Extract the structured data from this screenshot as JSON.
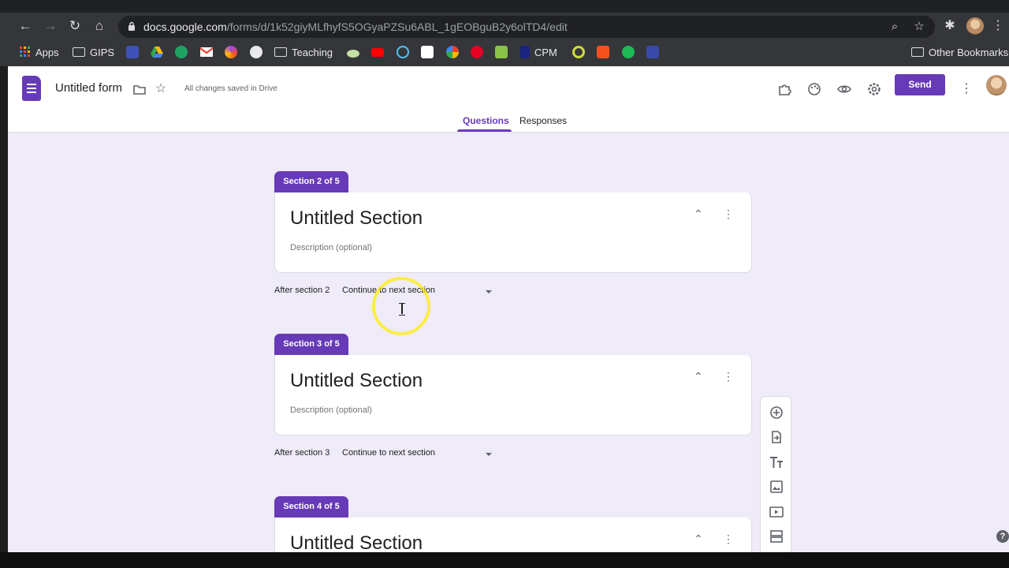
{
  "browser": {
    "url_host": "docs.google.com",
    "url_path": "/forms/d/1k52giyMLfhyfS5OGyaPZSu6ABL_1gEOBguB2y6olTD4/edit",
    "bookmarks": [
      {
        "label": "Apps",
        "icon": "apps-grid-icon"
      },
      {
        "label": "GIPS",
        "icon": "folder-icon"
      },
      {
        "label": "",
        "icon": "classroom-icon",
        "color": "#3f51b5"
      },
      {
        "label": "",
        "icon": "drive-icon",
        "color": "#34a853"
      },
      {
        "label": "",
        "icon": "app-icon",
        "color": "#1ea362"
      },
      {
        "label": "",
        "icon": "gmail-icon",
        "color": "#ea4335"
      },
      {
        "label": "",
        "icon": "app-icon",
        "color": "#a142f4"
      },
      {
        "label": "",
        "icon": "globe-icon",
        "color": "#e8eaed"
      },
      {
        "label": "Teaching",
        "icon": "folder-icon"
      },
      {
        "label": "",
        "icon": "app-icon",
        "color": "#c5e1a5"
      },
      {
        "label": "",
        "icon": "youtube-icon",
        "color": "#ff0000"
      },
      {
        "label": "",
        "icon": "app-icon",
        "color": "#4fc3f7"
      },
      {
        "label": "",
        "icon": "amazon-icon",
        "color": "#ffffff"
      },
      {
        "label": "",
        "icon": "google-icon",
        "color": "#ffffff"
      },
      {
        "label": "",
        "icon": "pinterest-icon",
        "color": "#e60023"
      },
      {
        "label": "",
        "icon": "app-icon",
        "color": "#8bc34a"
      },
      {
        "label": "CPM",
        "icon": "cpm-icon",
        "color": "#1a237e"
      },
      {
        "label": "",
        "icon": "app-icon",
        "color": "#cddc39"
      },
      {
        "label": "",
        "icon": "app-icon",
        "color": "#f4511e"
      },
      {
        "label": "",
        "icon": "spotify-icon",
        "color": "#1db954"
      },
      {
        "label": "",
        "icon": "app-icon",
        "color": "#3949ab"
      }
    ],
    "other_bookmarks": "Other Bookmarks"
  },
  "form": {
    "title": "Untitled form",
    "saved_status": "All changes saved in Drive",
    "send_label": "Send",
    "tabs": [
      "Questions",
      "Responses"
    ],
    "accent": "#673ab7"
  },
  "sections": [
    {
      "badge": "Section 2 of 5",
      "title": "Untitled Section",
      "description": "Description (optional)",
      "after_label": "After section 2",
      "after_value": "Continue to next section"
    },
    {
      "badge": "Section 3 of 5",
      "title": "Untitled Section",
      "description": "Description (optional)",
      "after_label": "After section 3",
      "after_value": "Continue to next section"
    },
    {
      "badge": "Section 4 of 5",
      "title": "Untitled Section"
    }
  ],
  "toolbar": [
    "add-question-icon",
    "import-questions-icon",
    "add-title-icon",
    "add-image-icon",
    "add-video-icon",
    "add-section-icon"
  ],
  "help_glyph": "?"
}
